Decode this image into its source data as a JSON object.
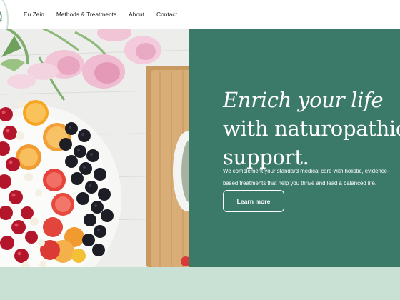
{
  "nav": {
    "items": [
      {
        "label": "Eu Zein"
      },
      {
        "label": "Methods & Treatments"
      },
      {
        "label": "About"
      },
      {
        "label": "Contact"
      }
    ]
  },
  "hero": {
    "title_line1": "Enrich your life",
    "title_line2": "with naturopathic",
    "title_line3": "support.",
    "subtitle_line1": "We complement your standard medical care with holistic, evidence-",
    "subtitle_line2": "based treatments that help you thrive and lead a balanced life.",
    "cta_label": "Learn more",
    "image_icon": "food-platter-photo"
  },
  "colors": {
    "panel_green": "#3b7a69",
    "bottom_band": "#c9e0d5",
    "text_white": "#ffffff"
  }
}
